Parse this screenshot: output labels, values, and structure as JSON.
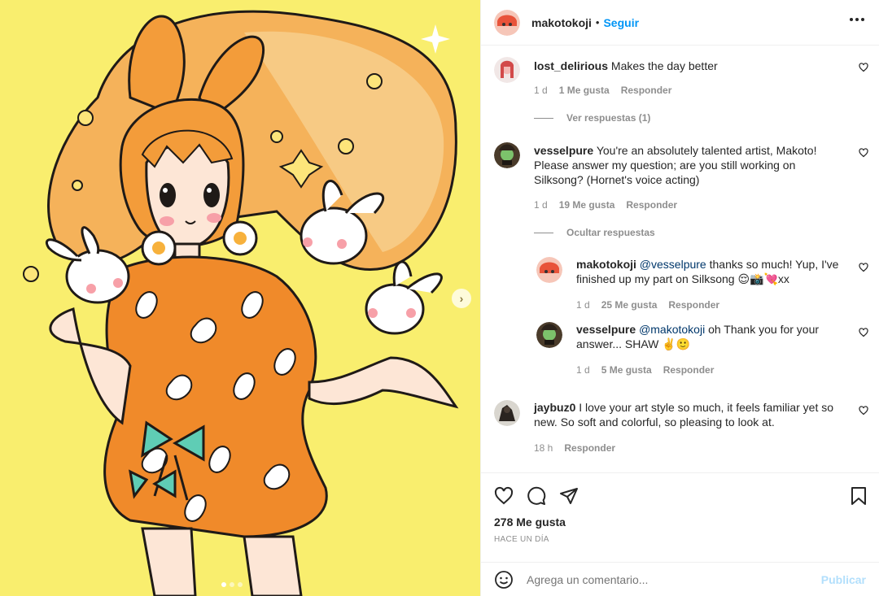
{
  "post": {
    "author": "makotokoji",
    "separator": "•",
    "follow_label": "Seguir",
    "more_icon": "more-horizontal-icon",
    "likes": "278 Me gusta",
    "time": "HACE UN DÍA"
  },
  "comments": [
    {
      "user": "lost_delirious",
      "text": "Makes the day better",
      "age": "1 d",
      "likes": "1 Me gusta",
      "reply_label": "Responder",
      "thread_toggle": "Ver respuestas (1)"
    },
    {
      "user": "vesselpure",
      "text": "You're an absolutely talented artist, Makoto! Please answer my question; are you still working on Silksong? (Hornet's voice acting)",
      "age": "1 d",
      "likes": "19 Me gusta",
      "reply_label": "Responder",
      "thread_toggle": "Ocultar respuestas",
      "replies": [
        {
          "user": "makotokoji",
          "mention": "@vesselpure",
          "text": " thanks so much! Yup, I've finished up my part on Silksong 😌📸💘xx",
          "age": "1 d",
          "likes": "25 Me gusta",
          "reply_label": "Responder"
        },
        {
          "user": "vesselpure",
          "mention": "@makotokoji",
          "text": " oh Thank you for your answer... SHAW ✌️🙂",
          "age": "1 d",
          "likes": "5 Me gusta",
          "reply_label": "Responder"
        }
      ]
    },
    {
      "user": "jaybuz0",
      "text": "I love your art style so much, it feels familiar yet so new. So soft and colorful, so pleasing to look at.",
      "age": "18 h",
      "reply_label": "Responder"
    }
  ],
  "compose": {
    "placeholder": "Agrega un comentario...",
    "publish_label": "Publicar"
  },
  "colors": {
    "link": "#0095f6",
    "publish_disabled": "#b2dffc",
    "art_background": "#f9ee6e",
    "art_orange": "#f08a2a"
  },
  "icons": [
    "heart-icon",
    "comment-icon",
    "share-icon",
    "bookmark-icon",
    "emoji-icon",
    "chevron-right-icon"
  ]
}
